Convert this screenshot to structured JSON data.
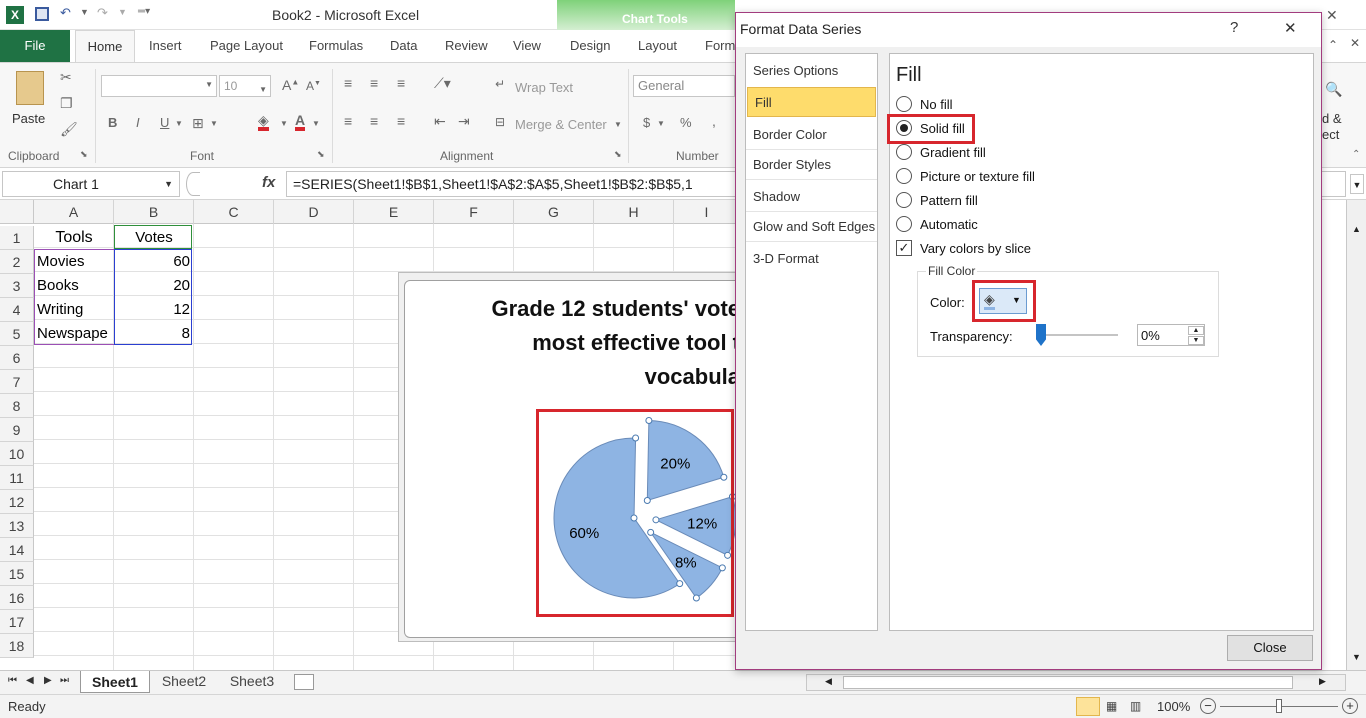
{
  "window": {
    "title": "Book2 - Microsoft Excel",
    "chart_tools": "Chart Tools"
  },
  "tabs": [
    "File",
    "Home",
    "Insert",
    "Page Layout",
    "Formulas",
    "Data",
    "Review",
    "View",
    "Design",
    "Layout",
    "Form"
  ],
  "ribbon": {
    "paste": "Paste",
    "font_size": "10",
    "wrap_text": "Wrap Text",
    "merge_center": "Merge & Center",
    "number_format": "General",
    "groups": {
      "clipboard": "Clipboard",
      "font": "Font",
      "alignment": "Alignment",
      "number": "Number"
    },
    "right_cut1": "d &",
    "right_cut2": "ect"
  },
  "formula_bar": {
    "name_box": "Chart 1",
    "fx": "fx",
    "formula": "=SERIES(Sheet1!$B$1,Sheet1!$A$2:$A$5,Sheet1!$B$2:$B$5,1"
  },
  "columns": [
    "A",
    "B",
    "C",
    "D",
    "E",
    "F",
    "G",
    "H",
    "I"
  ],
  "rows": [
    "1",
    "2",
    "3",
    "4",
    "5",
    "6",
    "7",
    "8",
    "9",
    "10",
    "11",
    "12",
    "13",
    "14",
    "15",
    "16",
    "17",
    "18"
  ],
  "cells": {
    "a1": "Tools",
    "b1": "Votes",
    "a2": "Movies",
    "b2": "60",
    "a3": "Books",
    "b3": "20",
    "a4": "Writing",
    "b4": "12",
    "a5": "Newspape",
    "b5": "8"
  },
  "chart": {
    "title_line1": "Grade 12 students' vote",
    "title_line2": "most effective tool t",
    "title_line3": "vocabula"
  },
  "chart_data": {
    "type": "pie",
    "categories": [
      "Movies",
      "Books",
      "Writing",
      "Newspape"
    ],
    "values": [
      60,
      20,
      12,
      8
    ],
    "labels": [
      "60%",
      "20%",
      "12%",
      "8%"
    ],
    "color": "#8eb4e3"
  },
  "sheets": [
    "Sheet1",
    "Sheet2",
    "Sheet3"
  ],
  "status": {
    "ready": "Ready",
    "zoom": "100%"
  },
  "dialog": {
    "title": "Format Data Series",
    "help": "?",
    "close_x": "✕",
    "nav": [
      "Series Options",
      "Fill",
      "Border Color",
      "Border Styles",
      "Shadow",
      "Glow and Soft Edges",
      "3-D Format"
    ],
    "section": "Fill",
    "options": [
      "No fill",
      "Solid fill",
      "Gradient fill",
      "Picture or texture fill",
      "Pattern fill",
      "Automatic"
    ],
    "vary_colors": "Vary colors by slice",
    "fill_color": "Fill Color",
    "color_label": "Color:",
    "transparency_label": "Transparency:",
    "transparency_value": "0%",
    "close_button": "Close"
  }
}
